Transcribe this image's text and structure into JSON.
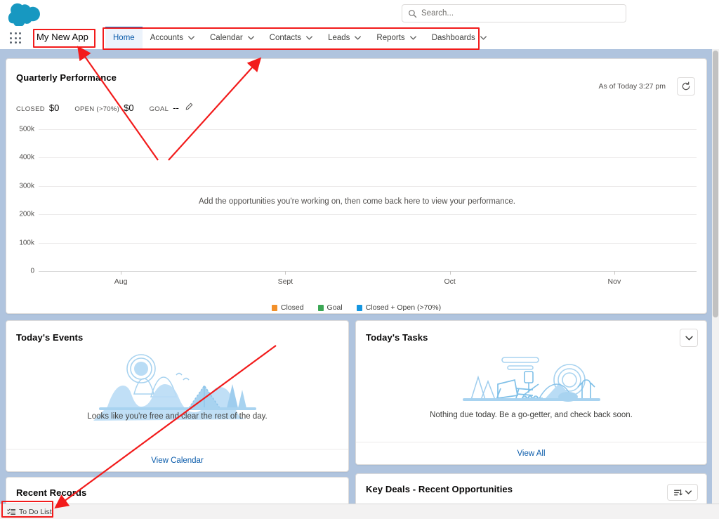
{
  "header": {
    "logo_alt": "salesforce-cloud-logo",
    "search": {
      "placeholder": "Search...",
      "value": ""
    }
  },
  "nav": {
    "app_launcher": "app-launcher",
    "app_name": "My New App",
    "tabs": [
      {
        "label": "Home",
        "has_dropdown": false,
        "active": true
      },
      {
        "label": "Accounts",
        "has_dropdown": true,
        "active": false
      },
      {
        "label": "Calendar",
        "has_dropdown": true,
        "active": false
      },
      {
        "label": "Contacts",
        "has_dropdown": true,
        "active": false
      },
      {
        "label": "Leads",
        "has_dropdown": true,
        "active": false
      },
      {
        "label": "Reports",
        "has_dropdown": true,
        "active": false
      },
      {
        "label": "Dashboards",
        "has_dropdown": true,
        "active": false
      }
    ]
  },
  "performance": {
    "title": "Quarterly Performance",
    "stats": [
      {
        "label": "CLOSED",
        "value": "$0"
      },
      {
        "label": "OPEN (>70%)",
        "value": "$0"
      },
      {
        "label": "GOAL",
        "value": "--"
      }
    ],
    "edit_goal_icon": "pencil-icon",
    "as_of": "As of Today 3:27 pm",
    "refresh_icon": "refresh-icon",
    "empty_message": "Add the opportunities you're working on, then come back here to view your performance."
  },
  "chart_data": {
    "type": "line",
    "title": "Quarterly Performance",
    "x": [
      "Aug",
      "Sept",
      "Oct",
      "Nov"
    ],
    "xlabel": "",
    "ylabel": "",
    "ylim": [
      0,
      500000
    ],
    "yticks": [
      0,
      100000,
      200000,
      300000,
      400000,
      500000
    ],
    "ytick_labels": [
      "0",
      "100k",
      "200k",
      "300k",
      "400k",
      "500k"
    ],
    "grid": true,
    "legend_position": "bottom",
    "series": [
      {
        "name": "Closed",
        "color": "#f2902a",
        "values": [
          0,
          0,
          0,
          0
        ]
      },
      {
        "name": "Goal",
        "color": "#3ba755",
        "values": [
          0,
          0,
          0,
          0
        ]
      },
      {
        "name": "Closed + Open (>70%)",
        "color": "#1596e0",
        "values": [
          0,
          0,
          0,
          0
        ]
      }
    ],
    "annotation": "Add the opportunities you're working on, then come back here to view your performance."
  },
  "events_card": {
    "title": "Today's Events",
    "illustration": "camping-scene-illustration",
    "empty_text": "Looks like you're free and clear the rest of the day.",
    "footer_link": "View Calendar"
  },
  "tasks_card": {
    "title": "Today's Tasks",
    "illustration": "desert-scene-illustration",
    "menu_icon": "chevron-down-icon",
    "empty_text": "Nothing due today. Be a go-getter, and check back soon.",
    "footer_link": "View All"
  },
  "recent_records_card": {
    "title": "Recent Records"
  },
  "key_deals_card": {
    "title": "Key Deals - Recent Opportunities",
    "sort_icon": "sort-list-icon",
    "menu_icon": "chevron-down-icon"
  },
  "utility_bar": {
    "items": [
      {
        "label": "To Do List",
        "icon": "checklist-icon"
      }
    ]
  },
  "colors": {
    "brand_blue": "#0176d3",
    "banner_blue": "#1b5297",
    "canvas": "#b0c4de",
    "annotation_red": "#f21b1b",
    "link_blue": "#0b5cab"
  }
}
